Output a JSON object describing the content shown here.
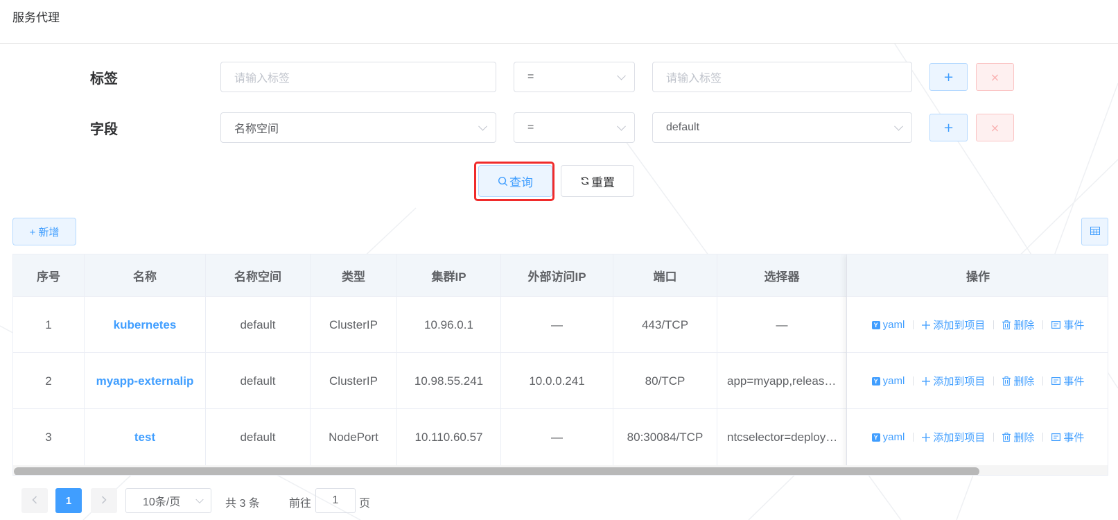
{
  "header": {
    "title": "服务代理"
  },
  "filters": {
    "label_row": {
      "label": "标签",
      "key_placeholder": "请输入标签",
      "operator": "=",
      "value_placeholder": "请输入标签",
      "add": "+",
      "remove": "×"
    },
    "field_row": {
      "label": "字段",
      "key_value": "名称空间",
      "operator": "=",
      "value": "default",
      "add": "+",
      "remove": "×"
    }
  },
  "actions": {
    "query": "查询",
    "reset": "重置",
    "new": "+ 新增"
  },
  "table": {
    "columns": [
      "序号",
      "名称",
      "名称空间",
      "类型",
      "集群IP",
      "外部访问IP",
      "端口",
      "选择器",
      "操作"
    ],
    "rows": [
      {
        "index": "1",
        "name": "kubernetes",
        "namespace": "default",
        "type": "ClusterIP",
        "cluster_ip": "10.96.0.1",
        "external_ip": "—",
        "port": "443/TCP",
        "selector": "—"
      },
      {
        "index": "2",
        "name": "myapp-externalip",
        "namespace": "default",
        "type": "ClusterIP",
        "cluster_ip": "10.98.55.241",
        "external_ip": "10.0.0.241",
        "port": "80/TCP",
        "selector": "app=myapp,release=…"
      },
      {
        "index": "3",
        "name": "test",
        "namespace": "default",
        "type": "NodePort",
        "cluster_ip": "10.110.60.57",
        "external_ip": "—",
        "port": "80:30084/TCP",
        "selector": "ntcselector=deploym…"
      }
    ],
    "row_actions": {
      "yaml_badge": "Y",
      "yaml": "yaml",
      "add_to_project": "添加到项目",
      "delete": "删除",
      "events": "事件"
    }
  },
  "pagination": {
    "current_page": "1",
    "page_size": "10条/页",
    "total": "共 3 条",
    "goto_prefix": "前往",
    "goto_value": "1",
    "goto_suffix": "页"
  },
  "colors": {
    "primary": "#409eff",
    "danger_outline": "#f02b2b",
    "header_bg": "#f2f6fa"
  }
}
